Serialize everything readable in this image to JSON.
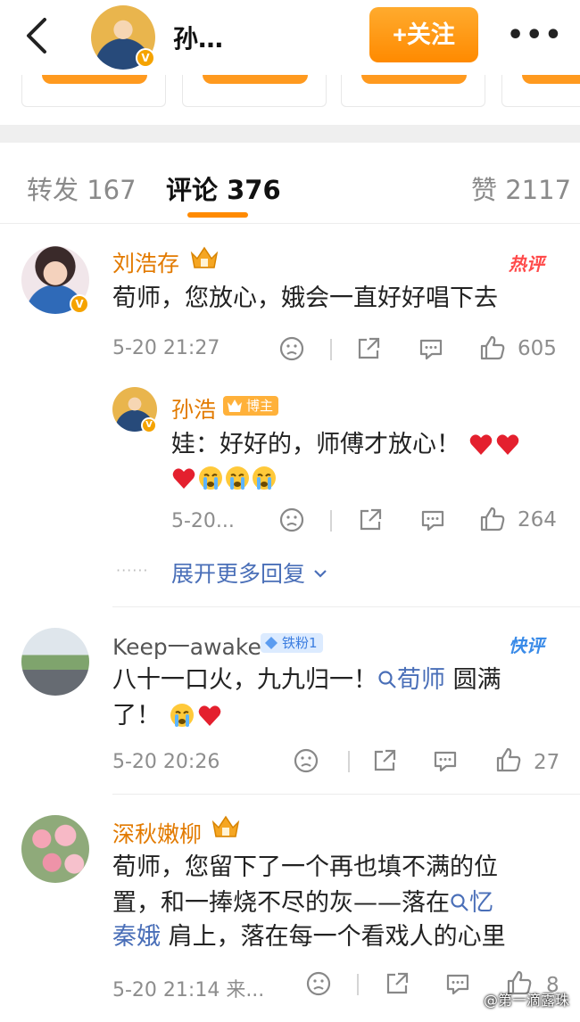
{
  "header": {
    "back_icon": "chevron-left-icon",
    "user_name": "孙…",
    "follow_label": "+关注",
    "more_icon": "more-dots-icon"
  },
  "tabs": {
    "repost": "转发 167",
    "comment": "评论 376",
    "like": "赞 2117"
  },
  "comments": [
    {
      "name": "刘浩存",
      "tag": "热评",
      "text": "荀师，您放心，娥会一直好好唱下去",
      "time": "5-20 21:27",
      "likes": "605",
      "reply": {
        "name": "孙浩",
        "badge": "博主",
        "text_line1": "娃：好好的，师傅才放心！",
        "time": "5-20...",
        "likes": "264"
      },
      "expand": "展开更多回复"
    },
    {
      "name": "Keep一awake",
      "badge": "铁粉1",
      "tag": "快评",
      "text_a": "八十一口火，九九归一！",
      "link": "荀师",
      "text_b": " 圆满",
      "text_c": "了！",
      "time": "5-20 20:26",
      "likes": "27"
    },
    {
      "name": "深秋嫩柳",
      "text_a": "荀师，您留下了一个再也填不满的位",
      "text_b": "置，和一捧烧不尽的灰——落在",
      "link": "忆",
      "link2": "秦娥",
      "text_c": " 肩上，落在每一个看戏人的心里",
      "time": "5-20 21:14  来...",
      "likes": "8"
    }
  ],
  "watermark": "@第一滴露珠",
  "colors": {
    "accent": "#ff8a00",
    "name": "#e27a00",
    "link": "#4a6fb8"
  }
}
